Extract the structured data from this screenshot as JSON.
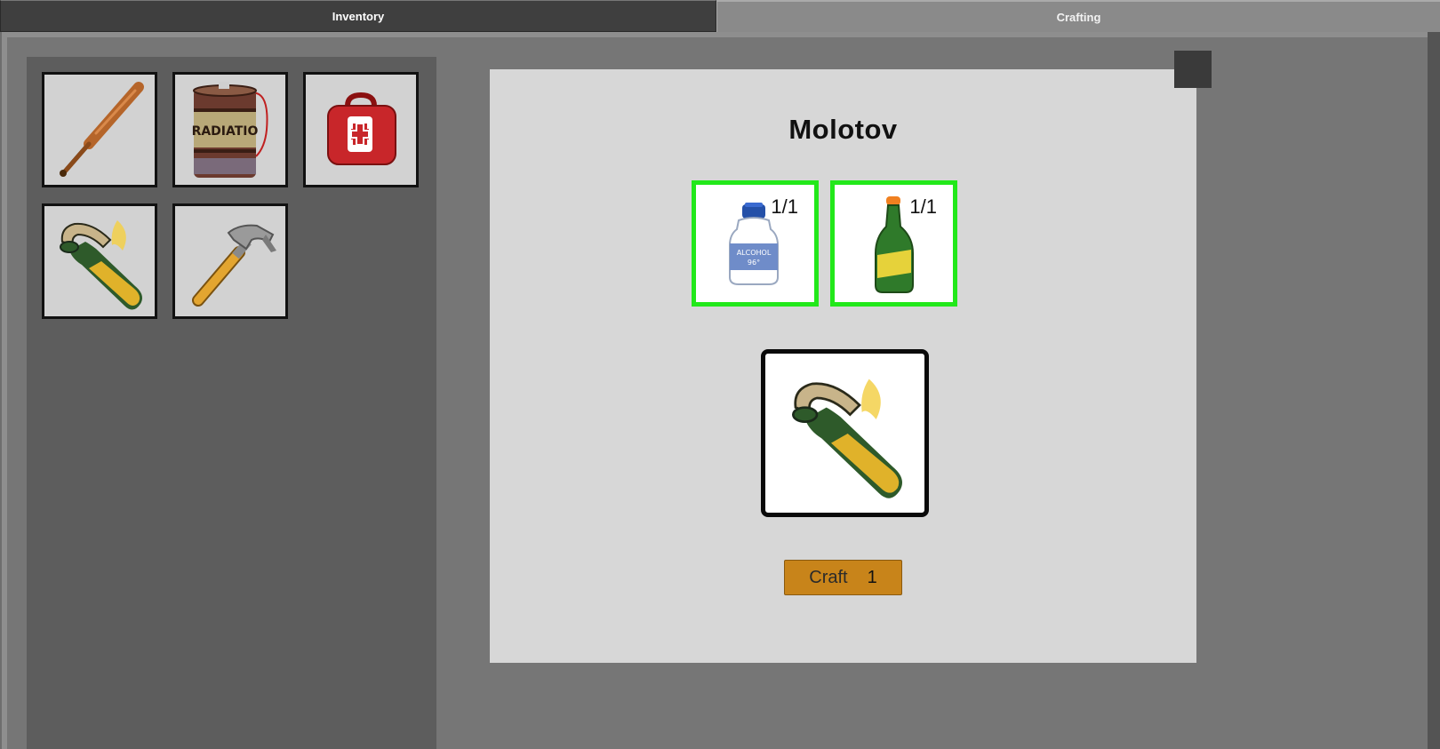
{
  "tabs": {
    "inventory_label": "Inventory",
    "crafting_label": "Crafting"
  },
  "inventory": {
    "items": [
      {
        "icon": "baseball-bat-icon"
      },
      {
        "icon": "radiation-barrel-icon",
        "label": "RADIATIO"
      },
      {
        "icon": "first-aid-kit-icon"
      },
      {
        "icon": "molotov-icon"
      },
      {
        "icon": "hammer-icon"
      }
    ]
  },
  "crafting": {
    "recipe_title": "Molotov",
    "ingredients": [
      {
        "icon": "alcohol-bottle-icon",
        "count": "1/1",
        "label_line1": "ALCOHOL",
        "label_line2": "96°"
      },
      {
        "icon": "green-bottle-icon",
        "count": "1/1"
      }
    ],
    "result": {
      "icon": "molotov-icon"
    },
    "craft_button": {
      "label": "Craft",
      "quantity": "1"
    }
  },
  "colors": {
    "ingredient_border": "#22e81a",
    "craft_button": "#c8841a"
  }
}
